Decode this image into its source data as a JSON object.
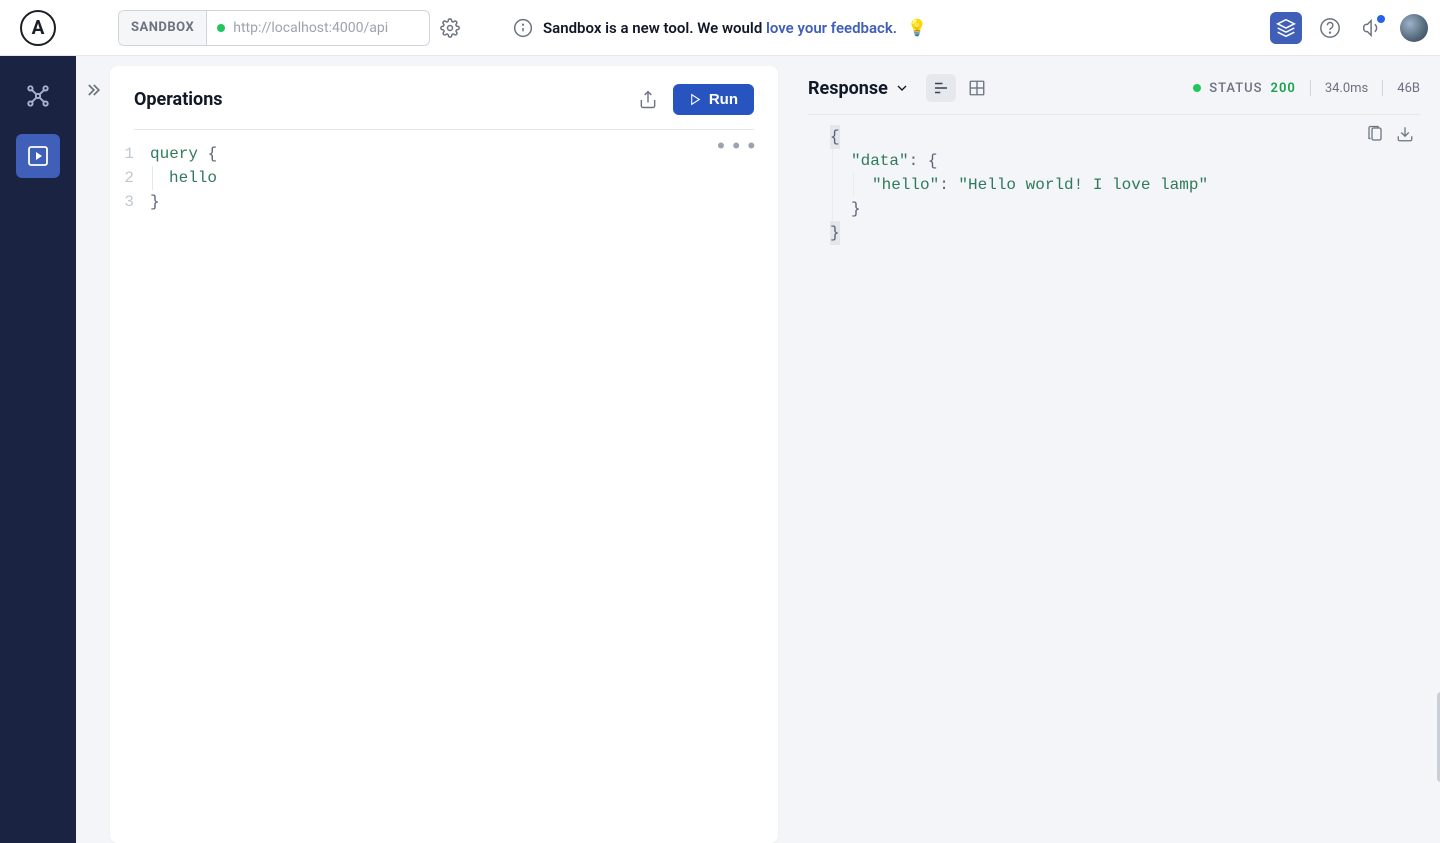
{
  "logo_letter": "A",
  "sandbox_badge": "SANDBOX",
  "endpoint_url": "http://localhost:4000/api",
  "banner": {
    "prefix": "Sandbox is a new tool. We would ",
    "link": "love your feedback.",
    "bulb": "💡"
  },
  "editor": {
    "title": "Operations",
    "run_label": "Run",
    "lines": {
      "n1": "1",
      "n2": "2",
      "n3": "3",
      "l1_kw": "query",
      "l1_brace": " {",
      "l2_field": "hello",
      "l3_brace": "}"
    }
  },
  "response": {
    "title": "Response",
    "status_label": "STATUS",
    "status_code": "200",
    "time": "34.0ms",
    "size": "46B",
    "body": {
      "open": "{",
      "data_key": "\"data\"",
      "colon_open": ": {",
      "hello_key": "\"hello\"",
      "colon": ": ",
      "hello_val": "\"Hello world! I love lamp\"",
      "close_inner": "}",
      "close": "}"
    }
  }
}
